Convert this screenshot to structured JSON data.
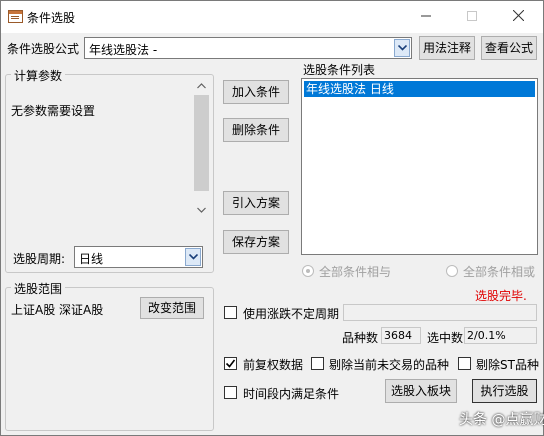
{
  "window": {
    "title": "条件选股"
  },
  "formula": {
    "label": "条件选股公式",
    "value": "年线选股法    -",
    "usage_button": "用法注释",
    "view_button": "查看公式"
  },
  "params": {
    "group_title": "计算参数",
    "message": "无参数需要设置",
    "period_label": "选股周期:",
    "period_value": "日线"
  },
  "conditions": {
    "list_title": "选股条件列表",
    "items": [
      "年线选股法    日线"
    ]
  },
  "actions": {
    "add": "加入条件",
    "delete": "删除条件",
    "import": "引入方案",
    "save": "保存方案"
  },
  "logic": {
    "all_and": "全部条件相与",
    "all_or": "全部条件相或"
  },
  "status": {
    "text": "选股完毕.",
    "color": "#e00000"
  },
  "scope": {
    "group_title": "选股范围",
    "value": "上证A股 深证A股",
    "change_button": "改变范围"
  },
  "options": {
    "limit_period": "使用涨跌不定周期",
    "stock_count_label": "品种数",
    "stock_count_value": "3684",
    "selected_label": "选中数",
    "selected_value": "2/0.1%",
    "forward_adj": "前复权数据",
    "exclude_untraded": "剔除当前未交易的品种",
    "exclude_st": "剔除ST品种",
    "time_period": "时间段内满足条件"
  },
  "bottom": {
    "to_block": "选股入板块",
    "execute": "执行选股"
  },
  "watermark": "头条 @点赢财经"
}
